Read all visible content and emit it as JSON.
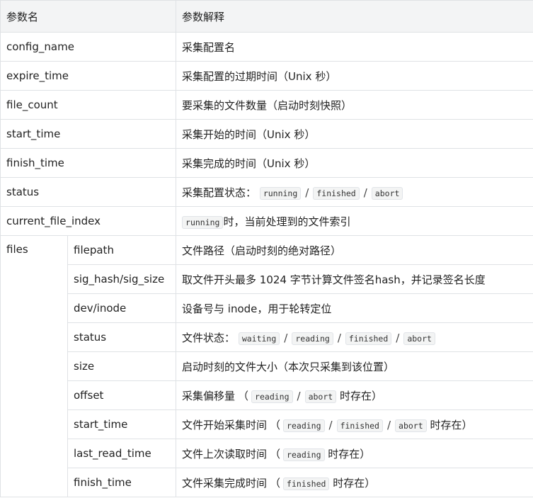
{
  "header": {
    "name": "参数名",
    "desc": "参数解释"
  },
  "rows": [
    {
      "name": "config_name",
      "desc": "采集配置名"
    },
    {
      "name": "expire_time",
      "desc": "采集配置的过期时间（Unix 秒）"
    },
    {
      "name": "file_count",
      "desc": "要采集的文件数量（启动时刻快照）"
    },
    {
      "name": "start_time",
      "desc": "采集开始的时间（Unix 秒）"
    },
    {
      "name": "finish_time",
      "desc": "采集完成的时间（Unix 秒）"
    },
    {
      "name": "status",
      "desc_prefix": "采集配置状态：",
      "codes": [
        "running",
        "finished",
        "abort"
      ]
    },
    {
      "name": "current_file_index",
      "code": "running",
      "desc_suffix": "时，当前处理到的文件索引"
    }
  ],
  "files": {
    "label": "files",
    "rows": [
      {
        "name": "filepath",
        "desc": "文件路径（启动时刻的绝对路径）"
      },
      {
        "name": "sig_hash/sig_size",
        "desc": "取文件开头最多 1024 字节计算文件签名hash，并记录签名长度"
      },
      {
        "name": "dev/inode",
        "desc": "设备号与 inode，用于轮转定位"
      },
      {
        "name": "status",
        "desc_prefix": "文件状态：",
        "codes": [
          "waiting",
          "reading",
          "finished",
          "abort"
        ]
      },
      {
        "name": "size",
        "desc": "启动时刻的文件大小（本次只采集到该位置）"
      },
      {
        "name": "offset",
        "desc_prefix": "采集偏移量",
        "paren_open": "（",
        "codes": [
          "reading",
          "abort"
        ],
        "desc_suffix": "时存在）"
      },
      {
        "name": "start_time",
        "desc_prefix": "文件开始采集时间",
        "paren_open": "（",
        "codes": [
          "reading",
          "finished",
          "abort"
        ],
        "desc_suffix": "时存在）"
      },
      {
        "name": "last_read_time",
        "desc_prefix": "文件上次读取时间",
        "paren_open": "（",
        "codes": [
          "reading"
        ],
        "desc_suffix": "时存在）"
      },
      {
        "name": "finish_time",
        "desc_prefix": "文件采集完成时间",
        "paren_open": "（",
        "codes": [
          "finished"
        ],
        "desc_suffix": "时存在）"
      }
    ]
  }
}
